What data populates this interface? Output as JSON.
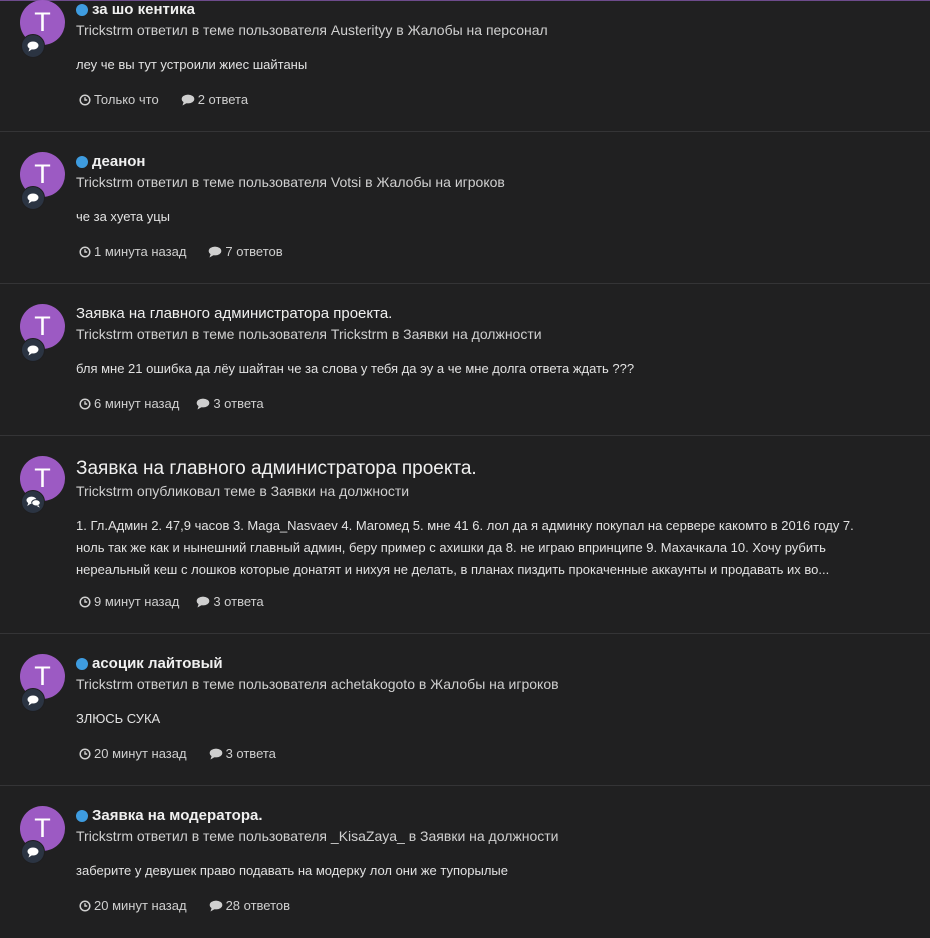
{
  "colors": {
    "background": "#202021",
    "avatar": "#9c5ac3",
    "unread_dot": "#3e9ce0",
    "divider": "#343436",
    "badge": "#2b3442"
  },
  "icons": {
    "clock": "clock-icon",
    "comment": "comment-icon",
    "badge_single": "comment-bubble-icon",
    "badge_double": "comments-icon"
  },
  "feed": [
    {
      "avatar_letter": "T",
      "unread": true,
      "title": "за шо кентика",
      "meta": "Trickstrm ответил в теме пользователя Austerityy в Жалобы на персонал",
      "snippet": "леу че вы тут устроили жиес шайтаны",
      "time": "Только что",
      "replies": "2 ответа"
    },
    {
      "avatar_letter": "T",
      "unread": true,
      "title": "деанон",
      "meta": "Trickstrm ответил в теме пользователя Votsi в Жалобы на игроков",
      "snippet": "че за хуета уцы",
      "time": "1 минута назад",
      "replies": "7 ответов"
    },
    {
      "avatar_letter": "T",
      "unread": false,
      "title": "Заявка на главного администратора проекта.",
      "meta": "Trickstrm ответил в теме пользователя Trickstrm в Заявки на должности",
      "snippet": "бля мне 21 ошибка да лёу шайтан че за слова у тебя да эу а че мне долга ответа ждать ???",
      "time": "6 минут назад",
      "replies": "3 ответа"
    },
    {
      "avatar_letter": "T",
      "unread": false,
      "title": "Заявка на главного администратора проекта.",
      "meta": "Trickstrm опубликовал теме в Заявки на должности",
      "snippet_lines": [
        "1. Гл.Админ 2. 47,9 часов 3. Maga_Nasvaev 4. Магомед 5. мне 41 6. лол да я админку покупал на сервере какомто в 2016 году 7.",
        "ноль так же как и нынешний главный админ, беру пример с ахишки да 8. не играю впринципе 9. Махачкала 10. Хочу рубить",
        "нереальный кеш с лошков которые донатят и нихуя не делать, в планах пиздить прокаченные аккаунты и продавать их во..."
      ],
      "time": "9 минут назад",
      "replies": "3 ответа"
    },
    {
      "avatar_letter": "T",
      "unread": true,
      "title": "асоцик лайтовый",
      "meta": "Trickstrm ответил в теме пользователя achetakogoto в Жалобы на игроков",
      "snippet": "ЗЛЮСЬ СУКА",
      "time": "20 минут назад",
      "replies": "3 ответа"
    },
    {
      "avatar_letter": "T",
      "unread": true,
      "title": "Заявка на модератора.",
      "meta": "Trickstrm ответил в теме пользователя _KisaZaya_ в Заявки на должности",
      "snippet": "заберите у девушек право подавать на модерку лол они же тупорылые",
      "time": "20 минут назад",
      "replies": "28 ответов"
    }
  ]
}
